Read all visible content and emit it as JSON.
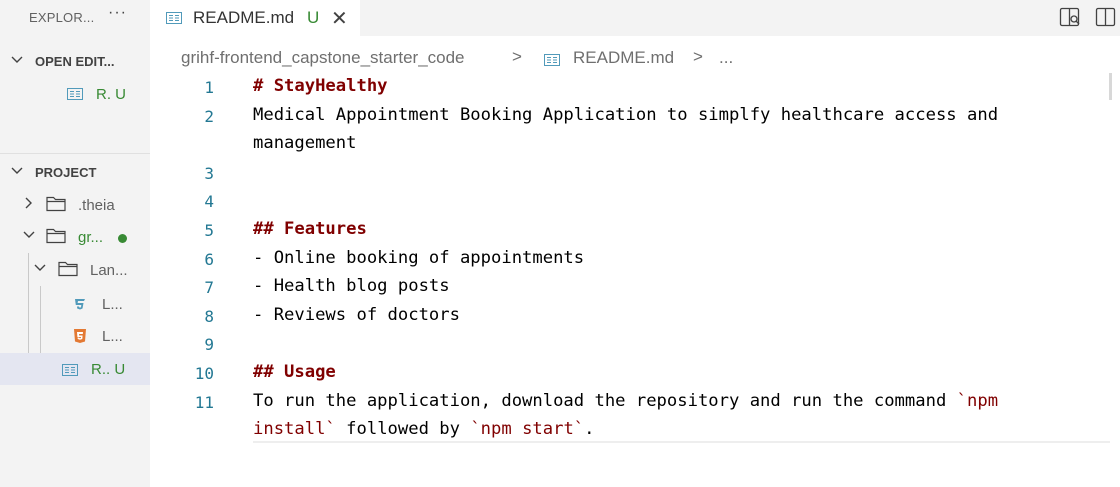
{
  "explorer": {
    "title": "EXPLOR...",
    "more": "···",
    "open_editors": {
      "label": "OPEN EDIT...",
      "items": [
        {
          "label": "R. U",
          "icon": "markdown-file-icon"
        }
      ]
    },
    "project": {
      "label": "PROJECT",
      "items": [
        {
          "label": ".theia",
          "icon": "folder-icon"
        },
        {
          "label": "gr...",
          "icon": "folder-icon",
          "modified_dot": true
        },
        {
          "label": "Lan...",
          "icon": "folder-icon"
        },
        {
          "label": "L...",
          "icon": "css-file-icon"
        },
        {
          "label": "L...",
          "icon": "html-file-icon"
        },
        {
          "label": "R.. U",
          "icon": "markdown-file-icon",
          "selected": true
        }
      ]
    }
  },
  "tab": {
    "label": "README.md",
    "status": "U",
    "close": "✕"
  },
  "breadcrumb": {
    "folder": "grihf-frontend_capstone_starter_code",
    "sep1": ">",
    "file": "README.md",
    "sep2": ">",
    "more": "..."
  },
  "editor": {
    "line_numbers": [
      "1",
      "2",
      "",
      "3",
      "4",
      "5",
      "6",
      "7",
      "8",
      "9",
      "10",
      "11",
      ""
    ],
    "lines": [
      {
        "parts": [
          {
            "text": "# StayHealthy",
            "style": "heading"
          }
        ]
      },
      {
        "parts": [
          {
            "text": "Medical Appointment Booking Application to simplfy healthcare access and",
            "style": "plain"
          }
        ]
      },
      {
        "parts": [
          {
            "text": "management",
            "style": "plain"
          }
        ]
      },
      {
        "parts": []
      },
      {
        "parts": []
      },
      {
        "parts": [
          {
            "text": "## Features",
            "style": "heading"
          }
        ]
      },
      {
        "parts": [
          {
            "text": "- Online booking of appointments",
            "style": "plain"
          }
        ]
      },
      {
        "parts": [
          {
            "text": "- Health blog posts",
            "style": "plain"
          }
        ]
      },
      {
        "parts": [
          {
            "text": "- Reviews of doctors",
            "style": "plain"
          }
        ]
      },
      {
        "parts": []
      },
      {
        "parts": [
          {
            "text": "## Usage",
            "style": "heading"
          }
        ]
      },
      {
        "parts": [
          {
            "text": "To run the application, download the repository and run the command ",
            "style": "plain"
          },
          {
            "text": "`npm",
            "style": "code"
          }
        ]
      },
      {
        "parts": [
          {
            "text": "install`",
            "style": "code"
          },
          {
            "text": " followed by ",
            "style": "plain"
          },
          {
            "text": "`npm start`",
            "style": "code"
          },
          {
            "text": ".",
            "style": "plain"
          }
        ]
      }
    ]
  },
  "colors": {
    "accent_modified": "#388a34",
    "line_number": "#237893",
    "heading": "#800000"
  }
}
